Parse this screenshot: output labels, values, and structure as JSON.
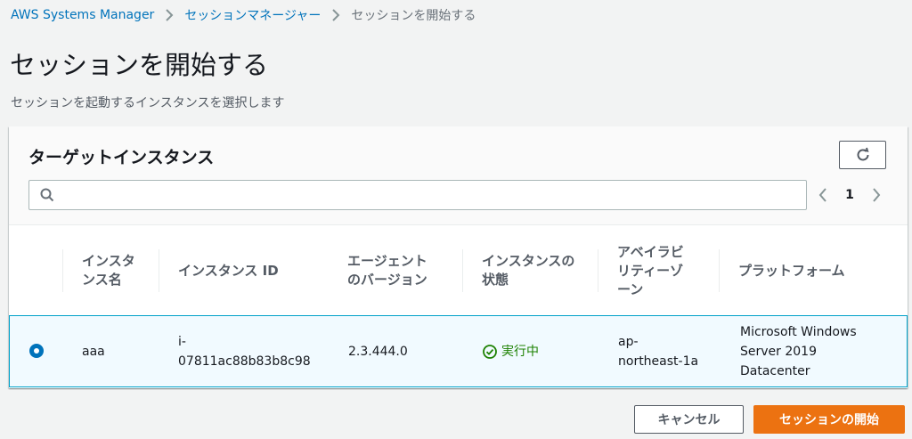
{
  "breadcrumb": {
    "items": [
      "AWS Systems Manager",
      "セッションマネージャー",
      "セッションを開始する"
    ]
  },
  "page": {
    "title": "セッションを開始する",
    "description": "セッションを起動するインスタンスを選択します"
  },
  "container": {
    "title": "ターゲットインスタンス",
    "search_placeholder": "",
    "page_number": "1"
  },
  "table": {
    "headers": [
      "インスタンス名",
      "インスタンス ID",
      "エージェントのバージョン",
      "インスタンスの状態",
      "アベイラビリティーゾーン",
      "プラットフォーム"
    ],
    "header_lines": [
      [
        "インスタ",
        "ンス名"
      ],
      [
        "インスタンス ID"
      ],
      [
        "エージェント",
        "のバージョン"
      ],
      [
        "インスタンスの",
        "状態"
      ],
      [
        "アベイラビ",
        "リティーゾ",
        "ーン"
      ],
      [
        "プラットフォーム"
      ]
    ],
    "rows": [
      {
        "selected": true,
        "name": "aaa",
        "instance_id_lines": [
          "i-",
          "07811ac88b83b8c98"
        ],
        "agent_version": "2.3.444.0",
        "state": "実行中",
        "az_lines": [
          "ap-",
          "northeast-1a"
        ],
        "platform_lines": [
          "Microsoft Windows",
          "Server 2019",
          "Datacenter"
        ]
      }
    ]
  },
  "actions": {
    "cancel": "キャンセル",
    "start": "セッションの開始"
  },
  "colors": {
    "link": "#0073bb",
    "primary": "#ec7211",
    "success": "#1d8102",
    "selected_bg": "#f1faff",
    "selected_border": "#00a1c9"
  }
}
